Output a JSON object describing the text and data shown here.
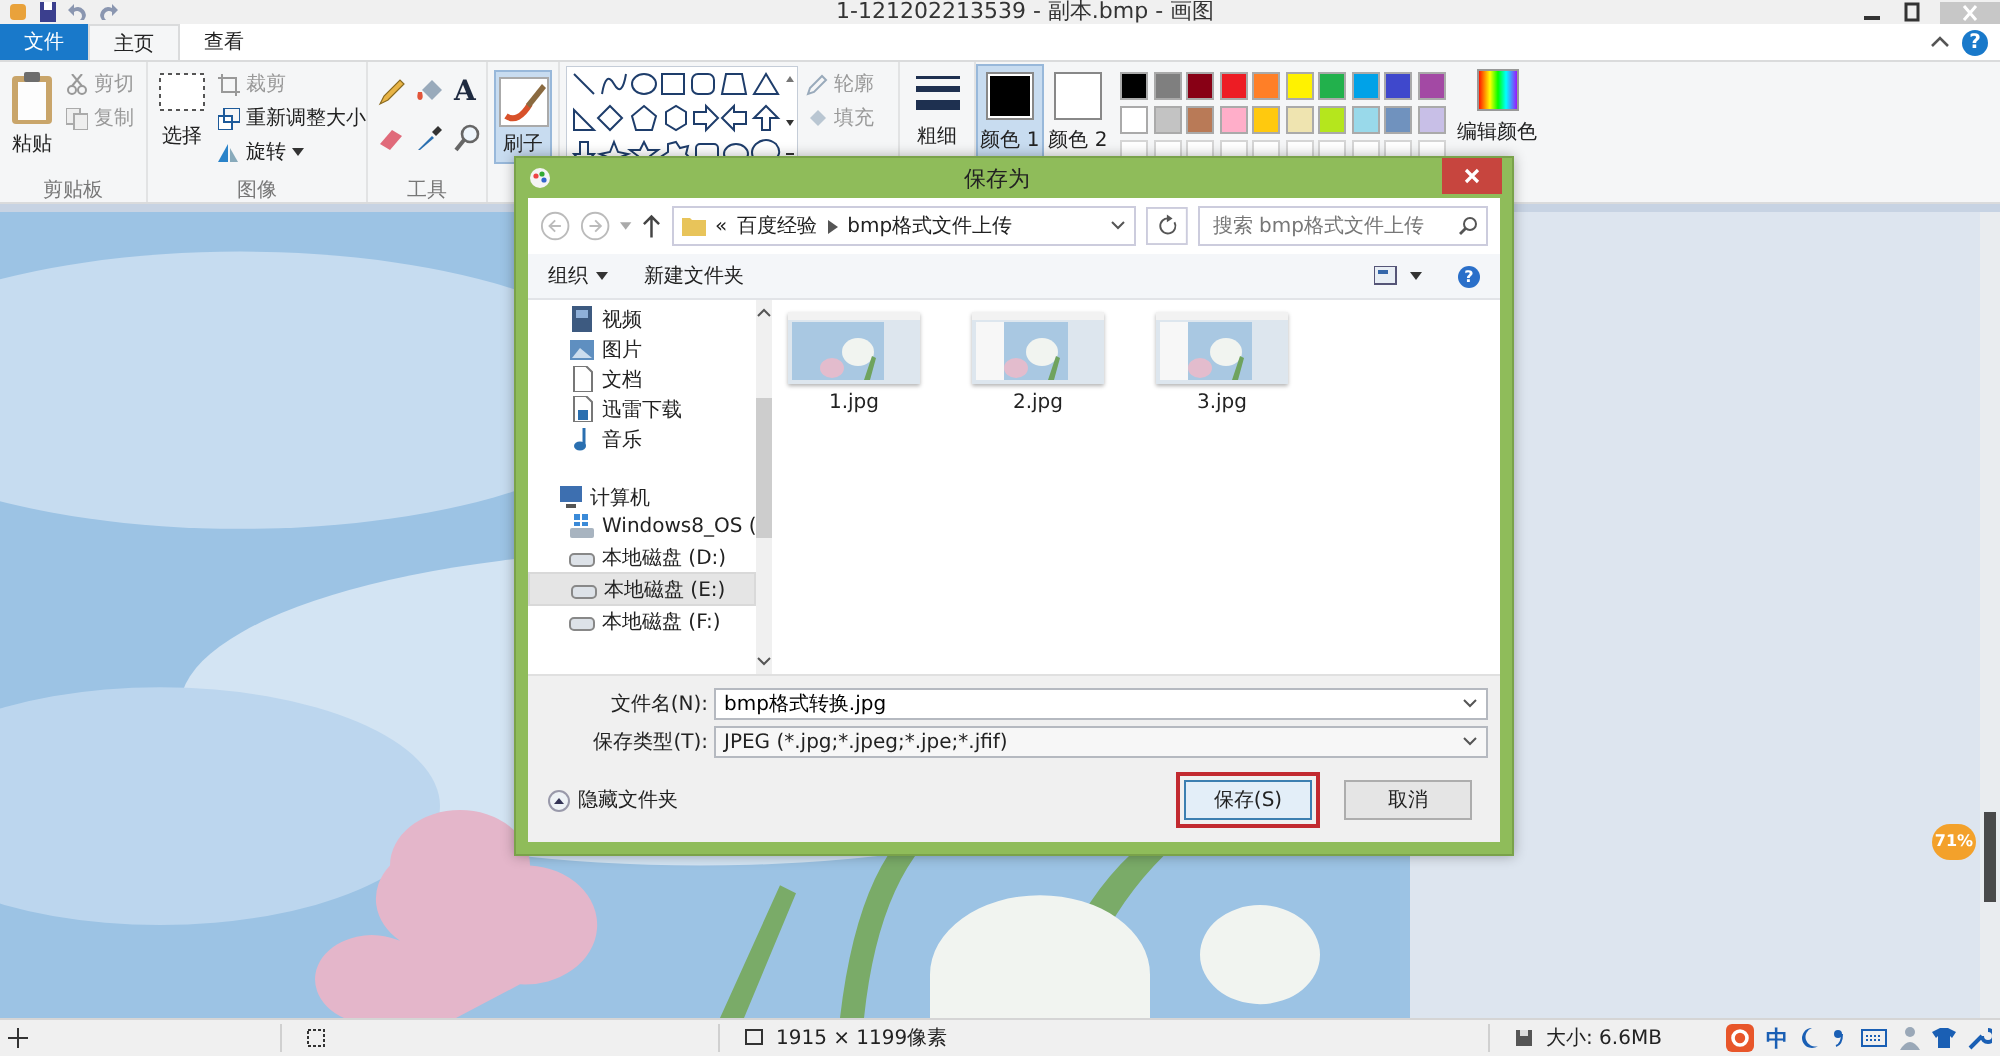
{
  "window": {
    "title": "1-121202213539 - 副本.bmp - 画图"
  },
  "tabs": [
    {
      "label": "文件",
      "kind": "file",
      "selected": false
    },
    {
      "label": "主页",
      "kind": "tab",
      "selected": true
    },
    {
      "label": "查看",
      "kind": "tab",
      "selected": false
    }
  ],
  "help": "?",
  "ribbon": {
    "clipboard": {
      "paste": "粘贴",
      "label": "剪贴板",
      "small": [
        {
          "label": "剪切",
          "kind": "cut",
          "disabled": true
        },
        {
          "label": "复制",
          "kind": "copy",
          "disabled": true
        }
      ]
    },
    "image": {
      "select": "选择",
      "label": "图像",
      "small": [
        {
          "label": "裁剪",
          "kind": "crop",
          "disabled": true
        },
        {
          "label": "重新调整大小",
          "kind": "resize",
          "disabled": false
        },
        {
          "label": "旋转",
          "kind": "rotate",
          "disabled": false
        }
      ]
    },
    "tools": {
      "text_glyph": "A",
      "label": "工具"
    },
    "brushes": {
      "label": "刷子",
      "selected": true
    },
    "shapes": {
      "outline": "轮廓",
      "fill": "填充",
      "disabled": true
    },
    "size": {
      "label": "粗细"
    },
    "colors": [
      {
        "label": "颜色 1",
        "color": "#000000",
        "selected": true
      },
      {
        "label": "颜色 2",
        "color": "#ffffff",
        "selected": false
      }
    ],
    "palette": [
      {
        "color": "#000000"
      },
      {
        "color": "#7f7f7f"
      },
      {
        "color": "#880015"
      },
      {
        "color": "#ed1c24"
      },
      {
        "color": "#ff7f27"
      },
      {
        "color": "#fff200"
      },
      {
        "color": "#22b14c"
      },
      {
        "color": "#00a2e8"
      },
      {
        "color": "#3f48cc"
      },
      {
        "color": "#a349a4"
      },
      {
        "color": "#ffffff"
      },
      {
        "color": "#c3c3c3"
      },
      {
        "color": "#b97a57"
      },
      {
        "color": "#ffaec9"
      },
      {
        "color": "#ffc90e"
      },
      {
        "color": "#efe4b0"
      },
      {
        "color": "#b5e61d"
      },
      {
        "color": "#99d9ea"
      },
      {
        "color": "#7092be"
      },
      {
        "color": "#c8bfe7"
      }
    ],
    "edit_colors": "编辑颜色"
  },
  "dialog": {
    "title": "保存为",
    "overflow": "«",
    "path": [
      "百度经验",
      "bmp格式文件上传"
    ],
    "search": {
      "placeholder": "搜索 bmp格式文件上传"
    },
    "organize": "组织",
    "new_folder": "新建文件夹",
    "help": "?",
    "nav": [
      {
        "label": "视频",
        "kind": "video",
        "selected": false
      },
      {
        "label": "图片",
        "kind": "pictures",
        "selected": false
      },
      {
        "label": "文档",
        "kind": "document",
        "selected": false
      },
      {
        "label": "迅雷下载",
        "kind": "download",
        "selected": false
      },
      {
        "label": "音乐",
        "kind": "music",
        "selected": false
      },
      {
        "label": "计算机",
        "kind": "computer",
        "selected": false,
        "children": [
          {
            "label": "Windows8_OS (",
            "kind": "os",
            "selected": false
          },
          {
            "label": "本地磁盘 (D:)",
            "kind": "drive",
            "selected": false
          },
          {
            "label": "本地磁盘 (E:)",
            "kind": "drive",
            "selected": true
          },
          {
            "label": "本地磁盘 (F:)",
            "kind": "drive",
            "selected": false
          }
        ]
      }
    ],
    "files": [
      {
        "name": "1.jpg"
      },
      {
        "name": "2.jpg"
      },
      {
        "name": "3.jpg"
      }
    ],
    "filename": {
      "label": "文件名(N):",
      "value": "bmp格式转换.jpg"
    },
    "filetype": {
      "label": "保存类型(T):",
      "value": "JPEG (*.jpg;*.jpeg;*.jpe;*.jfif)"
    },
    "hide_folders": "隐藏文件夹",
    "buttons": [
      {
        "label": "保存(S)",
        "kind": "primary",
        "highlighted": true
      },
      {
        "label": "取消",
        "kind": "secondary",
        "highlighted": false
      }
    ]
  },
  "status_bar": {
    "dimensions": "1915 × 1199像素",
    "size": "大小: 6.6MB",
    "ime": "中"
  },
  "badge": "71%"
}
